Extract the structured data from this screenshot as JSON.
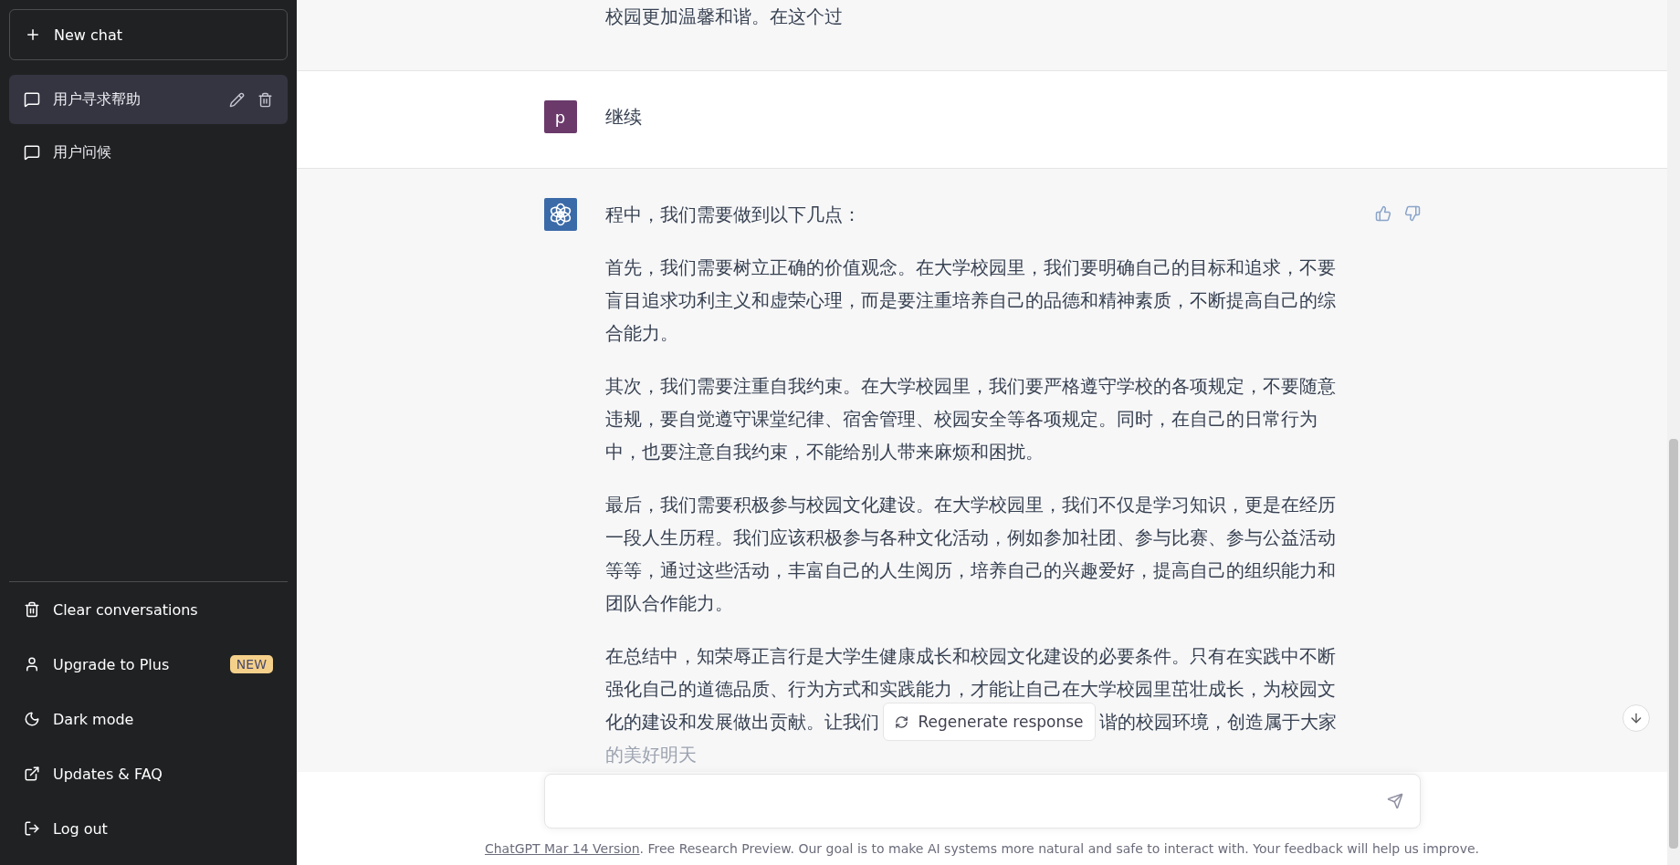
{
  "sidebar": {
    "new_chat": "New chat",
    "conversations": [
      {
        "title": "用户寻求帮助",
        "selected": true
      },
      {
        "title": "用户问候",
        "selected": false
      }
    ],
    "menu": [
      {
        "kind": "clear",
        "label": "Clear conversations"
      },
      {
        "kind": "upgrade",
        "label": "Upgrade to Plus",
        "badge": "NEW"
      },
      {
        "kind": "dark",
        "label": "Dark mode"
      },
      {
        "kind": "updates",
        "label": "Updates & FAQ"
      },
      {
        "kind": "logout",
        "label": "Log out"
      }
    ]
  },
  "messages": [
    {
      "kind": "assistant",
      "continued": true,
      "feedback": false,
      "paragraphs": [
        "校园更加温馨和谐。在这个过"
      ]
    },
    {
      "kind": "user",
      "avatar": "p",
      "continued": false,
      "feedback": false,
      "paragraphs": [
        "继续"
      ]
    },
    {
      "kind": "assistant",
      "continued": false,
      "feedback": true,
      "paragraphs": [
        "程中，我们需要做到以下几点：",
        "首先，我们需要树立正确的价值观念。在大学校园里，我们要明确自己的目标和追求，不要盲目追求功利主义和虚荣心理，而是要注重培养自己的品德和精神素质，不断提高自己的综合能力。",
        "其次，我们需要注重自我约束。在大学校园里，我们要严格遵守学校的各项规定，不要随意违规，要自觉遵守课堂纪律、宿舍管理、校园安全等各项规定。同时，在自己的日常行为中，也要注意自我约束，不能给别人带来麻烦和困扰。",
        "最后，我们需要积极参与校园文化建设。在大学校园里，我们不仅是学习知识，更是在经历一段人生历程。我们应该积极参与各种文化活动，例如参加社团、参与比赛、参与公益活动等等，通过这些活动，丰富自己的人生阅历，培养自己的兴趣爱好，提高自己的组织能力和团队合作能力。",
        {
          "before": "在总结中，知荣辱正言行是大学生健康成长和校园文化建设的必要条件。只有在实践中不断强化自己的道德品质、行为方式和实践能力，才能让自己在大学校园里茁壮成长，为校园文",
          "covered_row": [
            "化的建设和发展做出贡献。让我们",
            "谐的校园环境，创造属于大家"
          ],
          "after": "的美好明天"
        }
      ]
    }
  ],
  "regenerate": "Regenerate response",
  "footer": {
    "link": "ChatGPT Mar 14 Version",
    "text": ". Free Research Preview. Our goal is to make AI systems more natural and safe to interact with. Your feedback will help us improve."
  }
}
